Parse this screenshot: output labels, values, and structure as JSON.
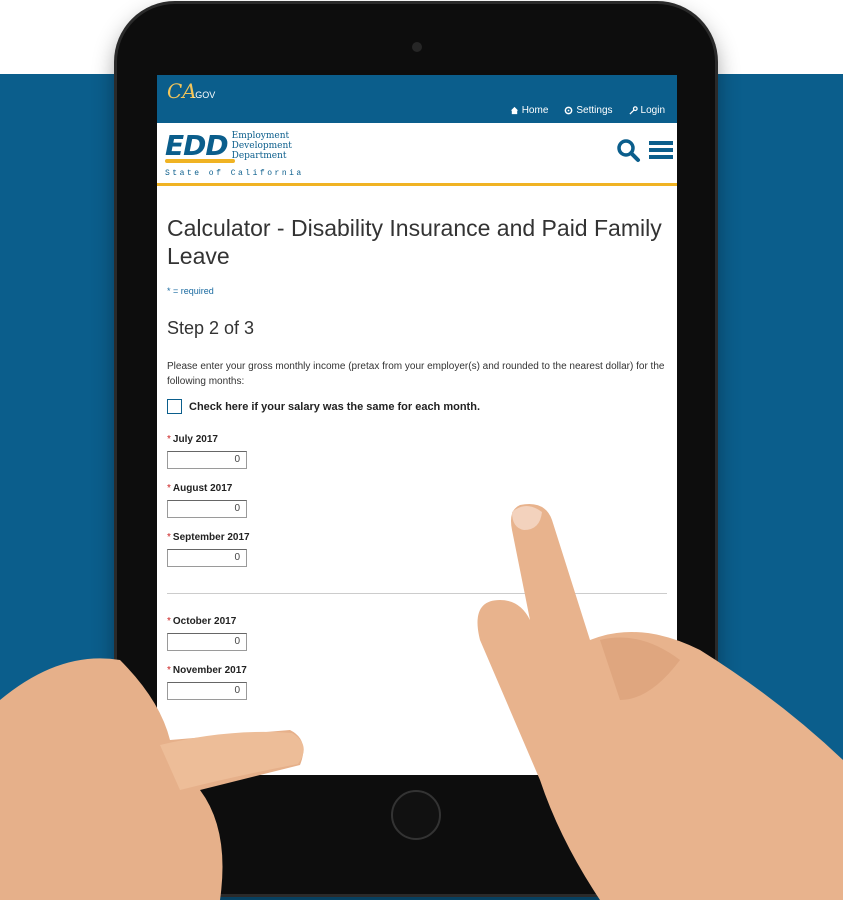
{
  "topbar": {
    "logo_text": "CA",
    "logo_sub": ".GOV",
    "links": [
      {
        "label": "Home",
        "icon": "home-icon"
      },
      {
        "label": "Settings",
        "icon": "gear-icon"
      },
      {
        "label": "Login",
        "icon": "key-icon"
      }
    ]
  },
  "header": {
    "logo_mark": "EDD",
    "logo_words": [
      "Employment",
      "Development",
      "Department"
    ],
    "logo_state": "State of California",
    "icons": [
      "search-icon",
      "menu-icon"
    ]
  },
  "main": {
    "title": "Calculator - Disability Insurance and Paid Family Leave",
    "required_note": "* = required",
    "step": "Step 2 of 3",
    "instructions": "Please enter your gross monthly income (pretax from your employer(s) and rounded to the nearest dollar) for the following months:",
    "same_salary_label": "Check here if your salary was the same for each month.",
    "months_group_1": [
      {
        "label": "July 2017",
        "value": "0"
      },
      {
        "label": "August 2017",
        "value": "0"
      },
      {
        "label": "September 2017",
        "value": "0"
      }
    ],
    "months_group_2": [
      {
        "label": "October 2017",
        "value": "0"
      },
      {
        "label": "November 2017",
        "value": "0"
      }
    ]
  },
  "colors": {
    "brand_blue": "#0b5e8c",
    "accent_gold": "#f0b323",
    "required_red": "#cc2222"
  }
}
